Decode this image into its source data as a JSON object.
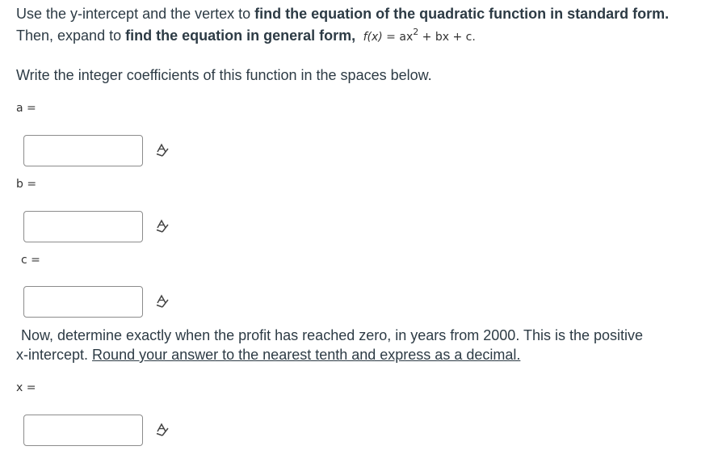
{
  "instructions": {
    "line1_text1": "Use the y-intercept and the vertex to ",
    "line1_bold": "find the equation of the quadratic function in standard form.",
    "line2_text1": "Then, expand to ",
    "line2_bold": "find the equation in general form,",
    "formula": {
      "fx": "f(x)",
      "eq": " = ax",
      "exp": "2",
      "rest": " + bx + c",
      "end": "."
    },
    "coeff_prompt": "Write the integer coefficients of this function in the spaces below."
  },
  "fields": {
    "a_label": "a =",
    "b_label": "b =",
    "c_label": "c =",
    "x_label": "x ="
  },
  "part2": {
    "line1": "Now, determine exactly when the profit has reached zero, in years from 2000.  This is the positive",
    "line2_text": "x-intercept.  ",
    "line2_underlined": "Round your answer to the nearest tenth and express as a decimal."
  },
  "icons": {
    "equation_editor": "equation-editor-icon"
  }
}
